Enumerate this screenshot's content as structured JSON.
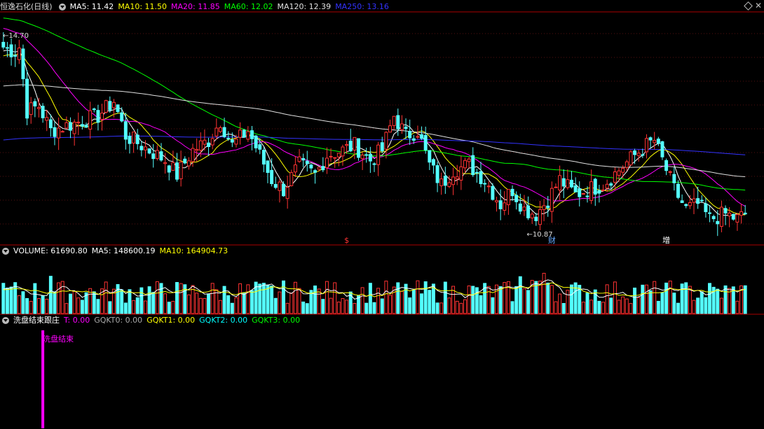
{
  "main_panel": {
    "title": "恒逸石化(日线)",
    "ma_labels": [
      {
        "text": "MA5: 11.42",
        "color": "#ffffff"
      },
      {
        "text": "MA10: 11.50",
        "color": "#ffff00"
      },
      {
        "text": "MA20: 11.85",
        "color": "#ff00ff"
      },
      {
        "text": "MA60: 12.02",
        "color": "#00ff00"
      },
      {
        "text": "MA120: 12.39",
        "color": "#e0e0e0"
      },
      {
        "text": "MA250: 13.16",
        "color": "#3333ff"
      }
    ],
    "high_label": "14.70",
    "low_label": "10.87",
    "markers": [
      {
        "text": "$",
        "color": "#ff3333",
        "bar": 87
      },
      {
        "text": "财",
        "color": "#66aaff",
        "bar": 139
      },
      {
        "text": "增",
        "color": "#ffffff",
        "bar": 168
      }
    ]
  },
  "volume_panel": {
    "labels": [
      {
        "text": "VOLUME: 61690.80",
        "color": "#ffffff"
      },
      {
        "text": "MA5: 148600.19",
        "color": "#ffffff"
      },
      {
        "text": "MA10: 164904.73",
        "color": "#ffff00"
      }
    ]
  },
  "indicator_panel": {
    "labels": [
      {
        "text": "洗盘结束跟庄",
        "color": "#ffffff"
      },
      {
        "text": "T: 0.00",
        "color": "#ff00ff"
      },
      {
        "text": "GQKT0: 0.00",
        "color": "#aaaaaa"
      },
      {
        "text": "GQKT1: 0.00",
        "color": "#ffff00"
      },
      {
        "text": "GQKT2: 0.00",
        "color": "#00ffff"
      },
      {
        "text": "GQKT3: 0.00",
        "color": "#00ff00"
      }
    ],
    "signal_text": "洗盘结束",
    "signal_bar": 10
  },
  "chart_data": {
    "type": "candlestick",
    "price_range": [
      10.6,
      15.3
    ],
    "n_bars": 189,
    "anchors_close": [
      [
        0,
        14.6
      ],
      [
        3,
        14.5
      ],
      [
        4,
        14.6
      ],
      [
        6,
        13.3
      ],
      [
        9,
        13.4
      ],
      [
        12,
        12.9
      ],
      [
        16,
        13.0
      ],
      [
        20,
        13.1
      ],
      [
        24,
        13.2
      ],
      [
        28,
        13.5
      ],
      [
        31,
        12.8
      ],
      [
        35,
        12.6
      ],
      [
        41,
        12.3
      ],
      [
        44,
        12.0
      ],
      [
        48,
        12.5
      ],
      [
        52,
        12.7
      ],
      [
        55,
        13.1
      ],
      [
        58,
        12.6
      ],
      [
        62,
        12.9
      ],
      [
        65,
        12.4
      ],
      [
        68,
        11.9
      ],
      [
        71,
        11.7
      ],
      [
        75,
        12.2
      ],
      [
        79,
        12.0
      ],
      [
        82,
        12.4
      ],
      [
        86,
        12.5
      ],
      [
        89,
        12.6
      ],
      [
        93,
        12.3
      ],
      [
        96,
        12.5
      ],
      [
        99,
        13.2
      ],
      [
        102,
        12.8
      ],
      [
        105,
        12.9
      ],
      [
        108,
        12.2
      ],
      [
        111,
        11.8
      ],
      [
        114,
        12.1
      ],
      [
        118,
        12.2
      ],
      [
        122,
        11.9
      ],
      [
        126,
        11.4
      ],
      [
        129,
        11.7
      ],
      [
        132,
        11.3
      ],
      [
        135,
        11.2
      ],
      [
        138,
        11.5
      ],
      [
        141,
        11.9
      ],
      [
        145,
        11.6
      ],
      [
        148,
        11.7
      ],
      [
        152,
        11.8
      ],
      [
        156,
        12.1
      ],
      [
        160,
        12.4
      ],
      [
        163,
        12.6
      ],
      [
        165,
        12.7
      ],
      [
        167,
        12.3
      ],
      [
        170,
        11.7
      ],
      [
        173,
        11.3
      ],
      [
        176,
        11.4
      ],
      [
        179,
        11.1
      ],
      [
        183,
        11.2
      ],
      [
        186,
        11.1
      ],
      [
        188,
        11.2
      ]
    ],
    "ma5": 11.42,
    "ma10": 11.5,
    "ma20": 11.85,
    "ma60": 12.02,
    "ma120": 12.39,
    "ma250": 13.16,
    "volume_last": 61690.8,
    "volume_ma5": 148600.19,
    "volume_ma10": 164904.73
  }
}
